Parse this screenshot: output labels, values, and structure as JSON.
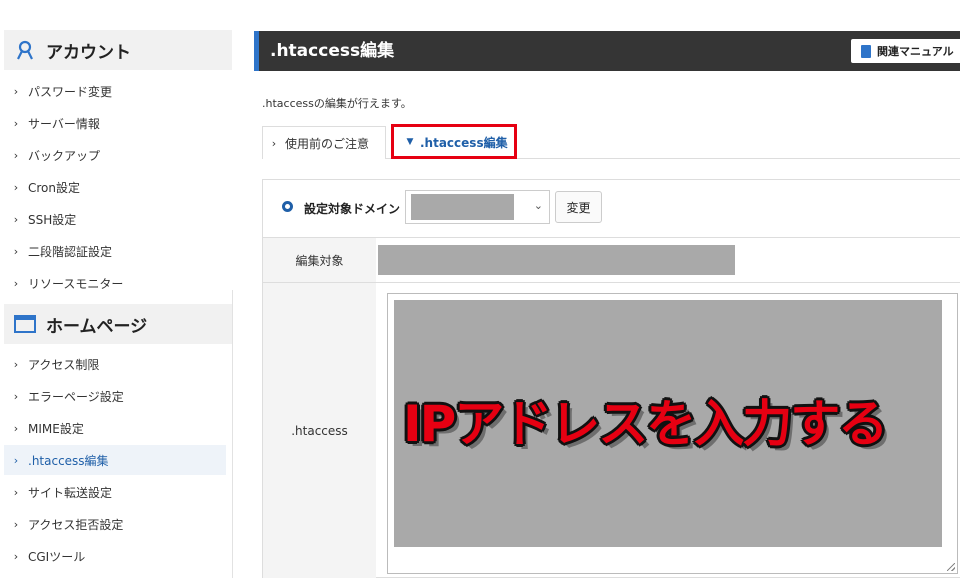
{
  "sidebar": {
    "account_title": "アカウント",
    "account_items": [
      {
        "label": "パスワード変更"
      },
      {
        "label": "サーバー情報"
      },
      {
        "label": "バックアップ"
      },
      {
        "label": "Cron設定"
      },
      {
        "label": "SSH設定"
      },
      {
        "label": "二段階認証設定"
      },
      {
        "label": "リソースモニター"
      }
    ],
    "homepage_title": "ホームページ",
    "homepage_items": [
      {
        "label": "アクセス制限"
      },
      {
        "label": "エラーページ設定"
      },
      {
        "label": "MIME設定"
      },
      {
        "label": ".htaccess編集",
        "active": true
      },
      {
        "label": "サイト転送設定"
      },
      {
        "label": "アクセス拒否設定"
      },
      {
        "label": "CGIツール"
      }
    ]
  },
  "header": {
    "title": ".htaccess編集",
    "manual_button": "関連マニュアル"
  },
  "main": {
    "description": ".htaccessの編集が行えます。",
    "tabs": [
      {
        "label": "使用前のご注意",
        "active": false
      },
      {
        "label": ".htaccess編集",
        "active": true
      }
    ],
    "domain_label": "設定対象ドメイン",
    "change_button": "変更",
    "edit_target_label": "編集対象",
    "htaccess_label": ".htaccess",
    "overlay_text": "IPアドレスを入力する"
  },
  "colors": {
    "accent": "#2e74c9",
    "header_bg": "#353535",
    "highlight": "#e60012",
    "masked": "#a9a9a9"
  }
}
